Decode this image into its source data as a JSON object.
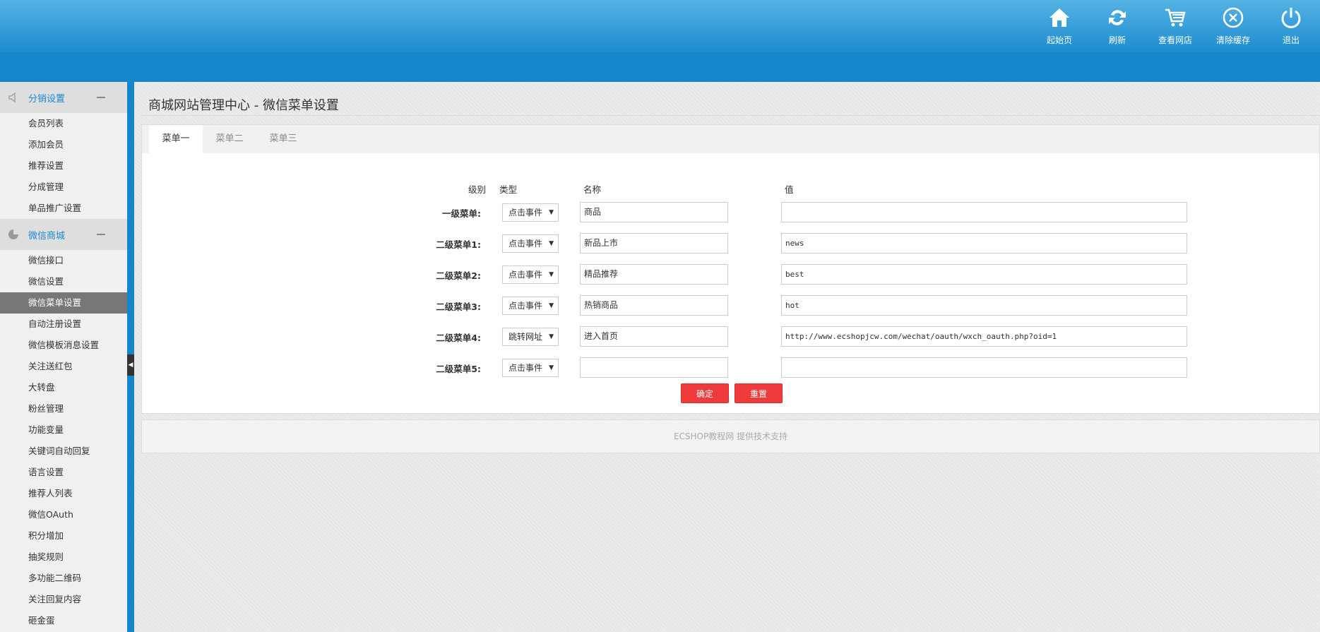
{
  "header": {
    "actions": [
      {
        "label": "起始页",
        "icon": "home-icon"
      },
      {
        "label": "刷新",
        "icon": "refresh-icon"
      },
      {
        "label": "查看网店",
        "icon": "cart-icon"
      },
      {
        "label": "清除缓存",
        "icon": "clear-cache-icon"
      },
      {
        "label": "退出",
        "icon": "power-icon"
      }
    ]
  },
  "sidebar": {
    "groups": [
      {
        "title": "分销设置",
        "icon": "speaker-icon",
        "items": [
          "会员列表",
          "添加会员",
          "推荐设置",
          "分成管理",
          "单品推广设置"
        ]
      },
      {
        "title": "微信商城",
        "icon": "pie-chart-icon",
        "items": [
          "微信接口",
          "微信设置",
          "微信菜单设置",
          "自动注册设置",
          "微信模板消息设置",
          "关注送红包",
          "大转盘",
          "粉丝管理",
          "功能变量",
          "关键词自动回复",
          "语言设置",
          "推荐人列表",
          "微信OAuth",
          "积分增加",
          "抽奖规则",
          "多功能二维码",
          "关注回复内容",
          "砸金蛋"
        ]
      }
    ],
    "active_item": "微信菜单设置"
  },
  "main": {
    "title": "商城网站管理中心 - 微信菜单设置",
    "tabs": [
      "菜单一",
      "菜单二",
      "菜单三"
    ],
    "active_tab": "菜单一",
    "columns": {
      "level": "级别",
      "type": "类型",
      "name": "名称",
      "value": "值"
    },
    "rows": [
      {
        "label": "一级菜单:",
        "type": "点击事件",
        "name": "商品",
        "value": ""
      },
      {
        "label": "二级菜单1:",
        "type": "点击事件",
        "name": "新品上市",
        "value": "news"
      },
      {
        "label": "二级菜单2:",
        "type": "点击事件",
        "name": "精品推荐",
        "value": "best"
      },
      {
        "label": "二级菜单3:",
        "type": "点击事件",
        "name": "热销商品",
        "value": "hot"
      },
      {
        "label": "二级菜单4:",
        "type": "跳转网址",
        "name": "进入首页",
        "value": "http://www.ecshopjcw.com/wechat/oauth/wxch_oauth.php?oid=1"
      },
      {
        "label": "二级菜单5:",
        "type": "点击事件",
        "name": "",
        "value": ""
      }
    ],
    "buttons": {
      "confirm": "确定",
      "reset": "重置"
    },
    "footer": "ECSHOP教程网 提供技术支持"
  }
}
